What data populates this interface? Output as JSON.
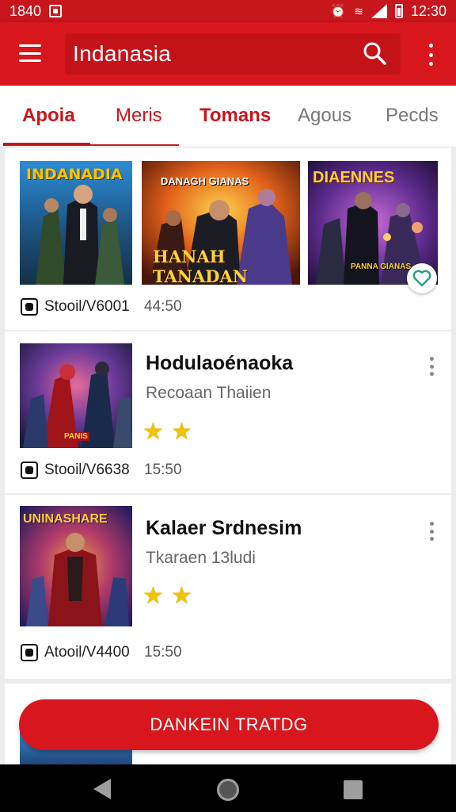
{
  "status_bar": {
    "time_left": "1840",
    "time_right": "12:30"
  },
  "app_bar": {
    "search_value": "Indanasia"
  },
  "tabs": [
    {
      "label": "Apoia"
    },
    {
      "label": "Meris"
    },
    {
      "label": "Tomans"
    },
    {
      "label": "Agous"
    },
    {
      "label": "Pecds"
    }
  ],
  "featured": {
    "thumbs": [
      {
        "title": "INDANADIA"
      },
      {
        "title_top": "DANAGH GIANAS",
        "title_bottom": "HANAH TANADAN"
      },
      {
        "title": "DIAENNES",
        "subtitle": "PANNA GIANAS"
      }
    ],
    "id": "Stooil/V6001",
    "time": "44:50"
  },
  "items": [
    {
      "thumb_tag": "PANIS",
      "title": "Hodulaoénaoka",
      "subtitle": "Recoaan Thaiien",
      "stars": 2,
      "id": "Stooil/V6638",
      "time": "15:50"
    },
    {
      "thumb_title": "UNINASHARE",
      "title": "Kalaer Srdnesim",
      "subtitle": "Tkaraen 13ludi",
      "stars": 2,
      "id": "Atooil/V4400",
      "time": "15:50"
    }
  ],
  "cta": {
    "label": "DANKEIN TRATDG"
  },
  "colors": {
    "brand_red": "#d7161e",
    "star": "#f2c300"
  }
}
